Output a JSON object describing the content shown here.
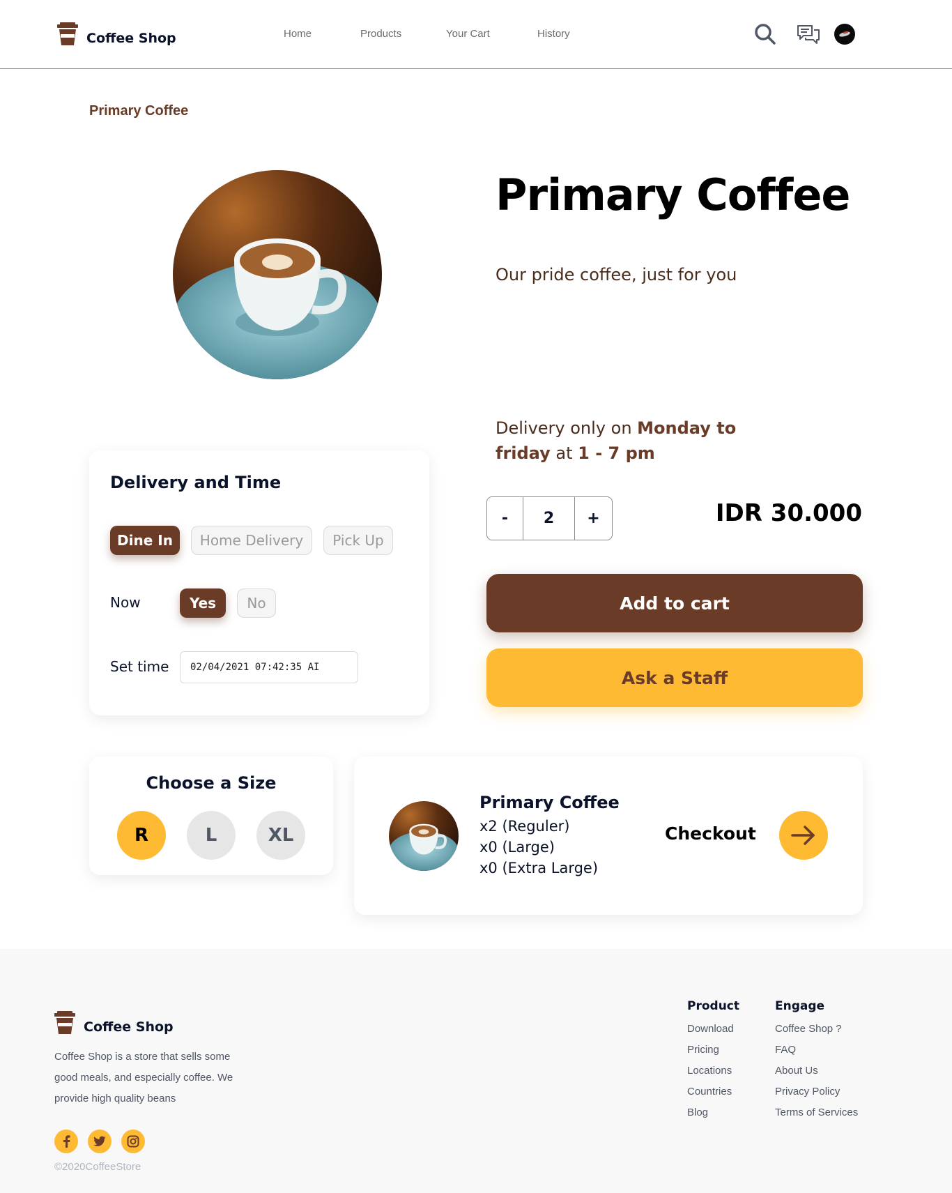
{
  "header": {
    "brand": "Coffee Shop",
    "nav": [
      "Home",
      "Products",
      "Your Cart",
      "History"
    ]
  },
  "breadcrumb": "Primary Coffee",
  "product": {
    "title": "Primary Coffee",
    "subtitle": "Our pride coffee, just for you",
    "delivery_note": {
      "prefix": "Delivery only on ",
      "days": "Monday to friday",
      "middle": " at ",
      "hours": "1 - 7 pm"
    },
    "quantity": "2",
    "minus_label": "-",
    "plus_label": "+",
    "price": "IDR 30.000",
    "add_to_cart": "Add to cart",
    "ask_staff": "Ask a Staff"
  },
  "delivery": {
    "title": "Delivery and Time",
    "methods": [
      "Dine In",
      "Home Delivery",
      "Pick Up"
    ],
    "selected_method": "Dine In",
    "now_label": "Now",
    "now_options": [
      "Yes",
      "No"
    ],
    "selected_now": "Yes",
    "set_time_label": "Set time",
    "set_time_value": "02/04/2021 07:42:35 AI"
  },
  "size": {
    "title": "Choose a Size",
    "options": [
      "R",
      "L",
      "XL"
    ],
    "selected": "R"
  },
  "checkout": {
    "product": "Primary Coffee",
    "lines": [
      "x2 (Reguler)",
      "x0 (Large)",
      "x0 (Extra Large)"
    ],
    "label": "Checkout"
  },
  "footer": {
    "brand": "Coffee Shop",
    "description": "Coffee Shop is a store that sells some good meals, and especially coffee. We provide high quality beans",
    "copyright": "©2020CoffeeStore",
    "product_col": {
      "title": "Product",
      "links": [
        "Download",
        "Pricing",
        "Locations",
        "Countries",
        "Blog"
      ]
    },
    "engage_col": {
      "title": "Engage",
      "links": [
        "Coffee Shop ?",
        "FAQ",
        "About Us",
        "Privacy Policy",
        "Terms of Services"
      ]
    }
  },
  "colors": {
    "brown": "#6a3b26",
    "yellow": "#ffba33",
    "dark": "#0b132a",
    "footer_bg": "#f8f8f8"
  }
}
